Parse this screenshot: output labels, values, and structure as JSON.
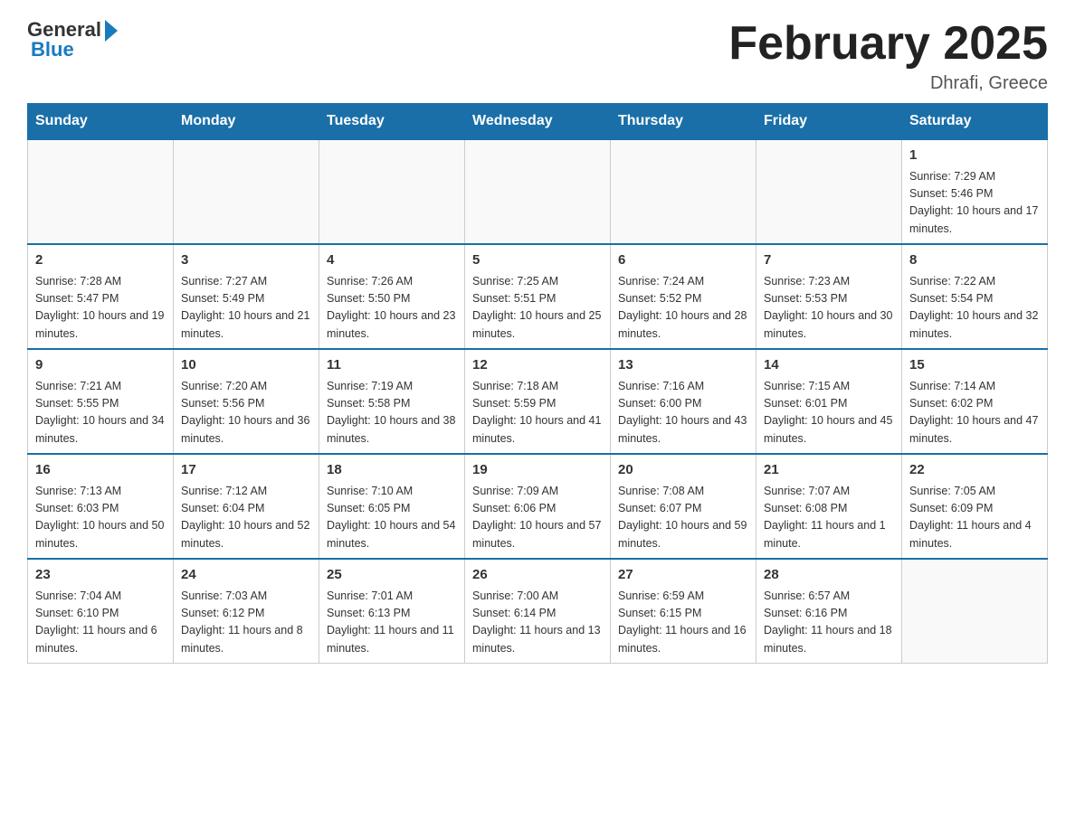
{
  "header": {
    "logo_general": "General",
    "logo_blue": "Blue",
    "month_title": "February 2025",
    "location": "Dhrafi, Greece"
  },
  "days_of_week": [
    "Sunday",
    "Monday",
    "Tuesday",
    "Wednesday",
    "Thursday",
    "Friday",
    "Saturday"
  ],
  "weeks": [
    [
      {
        "day": "",
        "sunrise": "",
        "sunset": "",
        "daylight": ""
      },
      {
        "day": "",
        "sunrise": "",
        "sunset": "",
        "daylight": ""
      },
      {
        "day": "",
        "sunrise": "",
        "sunset": "",
        "daylight": ""
      },
      {
        "day": "",
        "sunrise": "",
        "sunset": "",
        "daylight": ""
      },
      {
        "day": "",
        "sunrise": "",
        "sunset": "",
        "daylight": ""
      },
      {
        "day": "",
        "sunrise": "",
        "sunset": "",
        "daylight": ""
      },
      {
        "day": "1",
        "sunrise": "Sunrise: 7:29 AM",
        "sunset": "Sunset: 5:46 PM",
        "daylight": "Daylight: 10 hours and 17 minutes."
      }
    ],
    [
      {
        "day": "2",
        "sunrise": "Sunrise: 7:28 AM",
        "sunset": "Sunset: 5:47 PM",
        "daylight": "Daylight: 10 hours and 19 minutes."
      },
      {
        "day": "3",
        "sunrise": "Sunrise: 7:27 AM",
        "sunset": "Sunset: 5:49 PM",
        "daylight": "Daylight: 10 hours and 21 minutes."
      },
      {
        "day": "4",
        "sunrise": "Sunrise: 7:26 AM",
        "sunset": "Sunset: 5:50 PM",
        "daylight": "Daylight: 10 hours and 23 minutes."
      },
      {
        "day": "5",
        "sunrise": "Sunrise: 7:25 AM",
        "sunset": "Sunset: 5:51 PM",
        "daylight": "Daylight: 10 hours and 25 minutes."
      },
      {
        "day": "6",
        "sunrise": "Sunrise: 7:24 AM",
        "sunset": "Sunset: 5:52 PM",
        "daylight": "Daylight: 10 hours and 28 minutes."
      },
      {
        "day": "7",
        "sunrise": "Sunrise: 7:23 AM",
        "sunset": "Sunset: 5:53 PM",
        "daylight": "Daylight: 10 hours and 30 minutes."
      },
      {
        "day": "8",
        "sunrise": "Sunrise: 7:22 AM",
        "sunset": "Sunset: 5:54 PM",
        "daylight": "Daylight: 10 hours and 32 minutes."
      }
    ],
    [
      {
        "day": "9",
        "sunrise": "Sunrise: 7:21 AM",
        "sunset": "Sunset: 5:55 PM",
        "daylight": "Daylight: 10 hours and 34 minutes."
      },
      {
        "day": "10",
        "sunrise": "Sunrise: 7:20 AM",
        "sunset": "Sunset: 5:56 PM",
        "daylight": "Daylight: 10 hours and 36 minutes."
      },
      {
        "day": "11",
        "sunrise": "Sunrise: 7:19 AM",
        "sunset": "Sunset: 5:58 PM",
        "daylight": "Daylight: 10 hours and 38 minutes."
      },
      {
        "day": "12",
        "sunrise": "Sunrise: 7:18 AM",
        "sunset": "Sunset: 5:59 PM",
        "daylight": "Daylight: 10 hours and 41 minutes."
      },
      {
        "day": "13",
        "sunrise": "Sunrise: 7:16 AM",
        "sunset": "Sunset: 6:00 PM",
        "daylight": "Daylight: 10 hours and 43 minutes."
      },
      {
        "day": "14",
        "sunrise": "Sunrise: 7:15 AM",
        "sunset": "Sunset: 6:01 PM",
        "daylight": "Daylight: 10 hours and 45 minutes."
      },
      {
        "day": "15",
        "sunrise": "Sunrise: 7:14 AM",
        "sunset": "Sunset: 6:02 PM",
        "daylight": "Daylight: 10 hours and 47 minutes."
      }
    ],
    [
      {
        "day": "16",
        "sunrise": "Sunrise: 7:13 AM",
        "sunset": "Sunset: 6:03 PM",
        "daylight": "Daylight: 10 hours and 50 minutes."
      },
      {
        "day": "17",
        "sunrise": "Sunrise: 7:12 AM",
        "sunset": "Sunset: 6:04 PM",
        "daylight": "Daylight: 10 hours and 52 minutes."
      },
      {
        "day": "18",
        "sunrise": "Sunrise: 7:10 AM",
        "sunset": "Sunset: 6:05 PM",
        "daylight": "Daylight: 10 hours and 54 minutes."
      },
      {
        "day": "19",
        "sunrise": "Sunrise: 7:09 AM",
        "sunset": "Sunset: 6:06 PM",
        "daylight": "Daylight: 10 hours and 57 minutes."
      },
      {
        "day": "20",
        "sunrise": "Sunrise: 7:08 AM",
        "sunset": "Sunset: 6:07 PM",
        "daylight": "Daylight: 10 hours and 59 minutes."
      },
      {
        "day": "21",
        "sunrise": "Sunrise: 7:07 AM",
        "sunset": "Sunset: 6:08 PM",
        "daylight": "Daylight: 11 hours and 1 minute."
      },
      {
        "day": "22",
        "sunrise": "Sunrise: 7:05 AM",
        "sunset": "Sunset: 6:09 PM",
        "daylight": "Daylight: 11 hours and 4 minutes."
      }
    ],
    [
      {
        "day": "23",
        "sunrise": "Sunrise: 7:04 AM",
        "sunset": "Sunset: 6:10 PM",
        "daylight": "Daylight: 11 hours and 6 minutes."
      },
      {
        "day": "24",
        "sunrise": "Sunrise: 7:03 AM",
        "sunset": "Sunset: 6:12 PM",
        "daylight": "Daylight: 11 hours and 8 minutes."
      },
      {
        "day": "25",
        "sunrise": "Sunrise: 7:01 AM",
        "sunset": "Sunset: 6:13 PM",
        "daylight": "Daylight: 11 hours and 11 minutes."
      },
      {
        "day": "26",
        "sunrise": "Sunrise: 7:00 AM",
        "sunset": "Sunset: 6:14 PM",
        "daylight": "Daylight: 11 hours and 13 minutes."
      },
      {
        "day": "27",
        "sunrise": "Sunrise: 6:59 AM",
        "sunset": "Sunset: 6:15 PM",
        "daylight": "Daylight: 11 hours and 16 minutes."
      },
      {
        "day": "28",
        "sunrise": "Sunrise: 6:57 AM",
        "sunset": "Sunset: 6:16 PM",
        "daylight": "Daylight: 11 hours and 18 minutes."
      },
      {
        "day": "",
        "sunrise": "",
        "sunset": "",
        "daylight": ""
      }
    ]
  ]
}
